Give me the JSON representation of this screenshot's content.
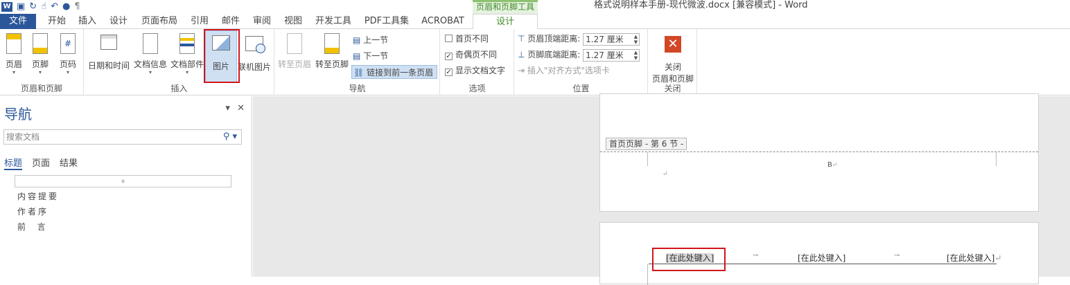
{
  "titlebar": {
    "contextual_tab_group": "页眉和页脚工具",
    "document_title": "格式说明样本手册-现代微波.docx [兼容模式] - Word"
  },
  "tabs": {
    "file": "文件",
    "home": "开始",
    "insert": "插入",
    "design_layout": "设计",
    "page_layout": "页面布局",
    "references": "引用",
    "mailings": "邮件",
    "review": "审阅",
    "view": "视图",
    "developer": "开发工具",
    "pdf": "PDF工具集",
    "acrobat": "ACROBAT",
    "design": "设计"
  },
  "ribbon": {
    "header_footer_group": {
      "label": "页眉和页脚",
      "header": "页眉",
      "footer": "页脚",
      "page_number": "页码"
    },
    "insert_group": {
      "label": "插入",
      "date_time": "日期和时间",
      "doc_info": "文档信息",
      "quick_parts": "文档部件",
      "picture": "图片",
      "online_picture": "联机图片"
    },
    "navigation_group": {
      "label": "导航",
      "goto_header": "转至页眉",
      "goto_footer": "转至页脚",
      "previous": "上一节",
      "next": "下一节",
      "link_previous": "链接到前一条页眉"
    },
    "options_group": {
      "label": "选项",
      "different_first": "首页不同",
      "different_odd_even": "奇偶页不同",
      "show_doc_text": "显示文档文字"
    },
    "position_group": {
      "label": "位置",
      "header_from_top_label": "页眉顶端距离:",
      "header_from_top_value": "1.27 厘米",
      "footer_from_bottom_label": "页脚底端距离:",
      "footer_from_bottom_value": "1.27 厘米",
      "insert_alignment_tab": "插入\"对齐方式\"选项卡"
    },
    "close_group": {
      "label": "关闭",
      "close_line1": "关闭",
      "close_line2": "页眉和页脚"
    }
  },
  "options_state": {
    "different_first": false,
    "different_odd_even": true,
    "show_doc_text": true
  },
  "nav": {
    "title": "导航",
    "search_placeholder": "搜索文档",
    "tabs": [
      "标题",
      "页面",
      "结果"
    ],
    "collapse_glyph": "⌅",
    "items": [
      "内容提要",
      "作者序",
      "前  言"
    ]
  },
  "document": {
    "footer_tag": "首页页脚 - 第 6 节 -",
    "footer_content": "B",
    "header_fields": [
      "[在此处键入]",
      "[在此处键入]",
      "[在此处键入]"
    ]
  },
  "colors": {
    "accent": "#2b579a",
    "contextual_green": "#3f8a28",
    "highlight_red": "#d0161b"
  }
}
